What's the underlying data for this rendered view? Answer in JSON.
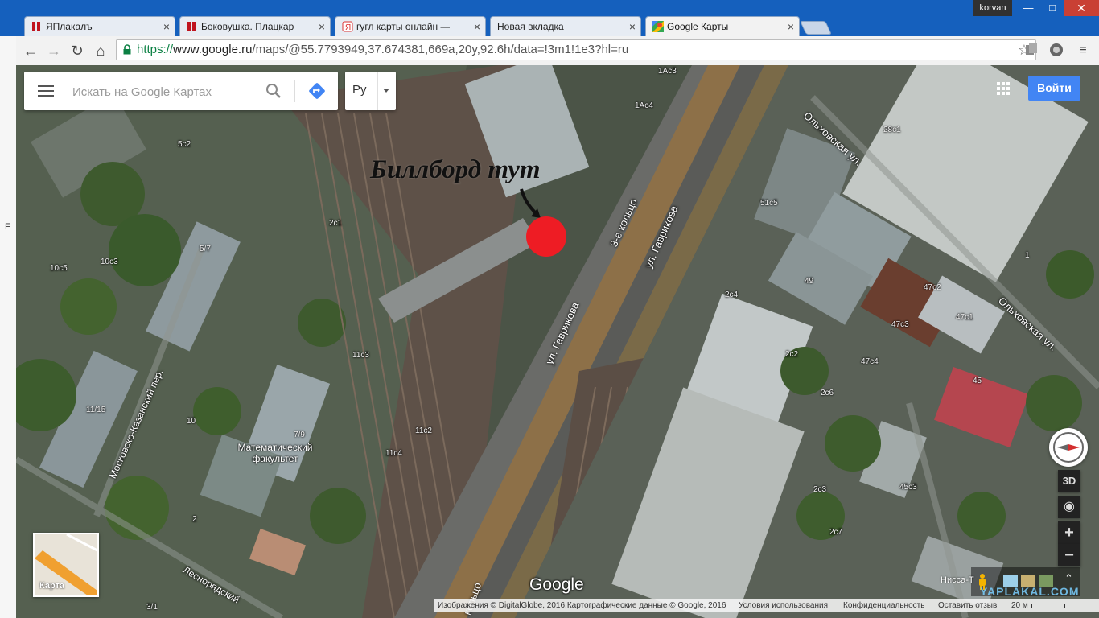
{
  "browser": {
    "tabs": [
      {
        "title": "ЯПлакалъ",
        "active": false
      },
      {
        "title": "Боковушка. Плацкартный",
        "active": false
      },
      {
        "title": "гугл карты онлайн — Янд",
        "active": false
      },
      {
        "title": "Новая вкладка",
        "active": false
      },
      {
        "title": "Google Карты",
        "active": true
      }
    ],
    "user": "korvan",
    "url_protocol": "https://",
    "url_host": "www.google.ru",
    "url_path": "/maps/@55.7793949,37.674381,669a,20y,92.6h/data=!3m1!1e3?hl=ru",
    "left_edge_char": "F",
    "colors": {
      "titlebar": "#1560bd",
      "close": "#c94034"
    }
  },
  "maps": {
    "search_placeholder": "Искать на Google Картах",
    "language": "Ру",
    "signin_label": "Войти",
    "mode_3d": "3D",
    "zoom_in": "+",
    "zoom_out": "−",
    "minimap_label": "Карта",
    "logo": "Google",
    "accent": "#4285f4"
  },
  "annotation": {
    "text": "Биллборд тут",
    "marker_color": "#ee1c24"
  },
  "streets": {
    "ring_road": "3-е кольцо",
    "gavrikova_1": "ул. Гаврикова",
    "gavrikova_2": "ул. Гаврикова",
    "olkhovskaya_1": "Ольховская ул.",
    "olkhovskaya_2": "Ольховская ул.",
    "moskovsko_kazansky": "Московско-Казанский пер.",
    "lesnoryadsky": "Леснорядский",
    "ring_road_bottom": "кольцо"
  },
  "poi": {
    "math_faculty": "Математический факультет"
  },
  "building_numbers": {
    "b1Ac3": "1Ac3",
    "b1Ac4": "1Ac4",
    "b5c2": "5c2",
    "b28c1": "28c1",
    "b51c5": "51c5",
    "b2c1": "2c1",
    "b10c5": "10c5",
    "b10c3": "10c3",
    "b5_7": "5/7",
    "b49": "49",
    "b1": "1",
    "b2c4": "2c4",
    "b47c2": "47c2",
    "b47c3": "47c3",
    "b47c1": "47c1",
    "b11c3": "11c3",
    "b2c2": "2c2",
    "b47c4": "47c4",
    "b45": "45",
    "b2c6": "2c6",
    "b11_15": "11/15",
    "b10": "10",
    "b7_9": "7/9",
    "b11c2": "11c2",
    "b11c4": "11c4",
    "b2c3": "2c3",
    "b45c3": "45c3",
    "b2": "2",
    "b2c7": "2c7",
    "b3_1": "3/1"
  },
  "footer": {
    "imagery": "Изображения © DigitalGlobe, 2016,Картографические данные © Google, 2016",
    "terms": "Условия использования",
    "privacy": "Конфиденциальность",
    "feedback": "Оставить отзыв",
    "scale": "20 м",
    "place_label": "Нисса-Т"
  },
  "watermark": "YAPLAKAL.COM"
}
